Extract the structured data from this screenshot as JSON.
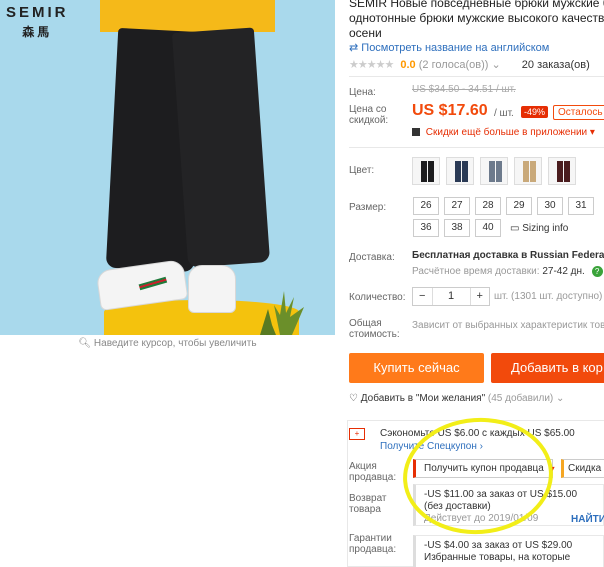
{
  "brand": {
    "name": "SEMIR",
    "sub": "森馬"
  },
  "zoom_hint": "Наведите курсор, чтобы увеличить",
  "product": {
    "title_line1": "SEMIR Новые повседневные брюки мужские бре",
    "title_line2": "однотонные брюки мужские высокого качества",
    "title_line3": "осени",
    "translate_link": "Посмотреть название на английском",
    "stars": "★★★★★",
    "score": "0.0",
    "votes": "(2 голоса(ов))",
    "votes_arrow": "⌄",
    "orders": "20 заказа(ов)"
  },
  "price": {
    "label": "Цена:",
    "old": "US $34.50 - 34.51 / шт.",
    "sale_label": "Цена со скидкой:",
    "new": "US $17.60",
    "per_unit": "/ шт.",
    "discount": "-49%",
    "remaining": "Осталось д",
    "app_discount": "Скидки ещё больше в приложении",
    "app_arrow": "▾"
  },
  "color": {
    "label": "Цвет:",
    "swatches": [
      "#1c1c1e",
      "#2a3a55",
      "#6d7a8c",
      "#c9a97a",
      "#4a1c1e"
    ]
  },
  "size": {
    "label": "Размер:",
    "row1": [
      "26",
      "27",
      "28",
      "29",
      "30",
      "31"
    ],
    "row2": [
      "36",
      "38",
      "40"
    ],
    "sizing_info": "Sizing info"
  },
  "delivery": {
    "label": "Доставка:",
    "main": "Бесплатная доставка в Russian Federation",
    "eta_label": "Расчётное время доставки:",
    "eta": "27-42 дн.",
    "ok": "?"
  },
  "quantity": {
    "label": "Количество:",
    "minus": "−",
    "value": "1",
    "plus": "+",
    "available": "шт. (1301 шт. доступно)"
  },
  "total": {
    "label": "Общая стоимость:",
    "note": "Зависит от выбранных характеристик товар"
  },
  "actions": {
    "buy_now": "Купить сейчас",
    "add_cart": "Добавить в кор",
    "wishlist": "Добавить в \"Мои желания\"",
    "wishlist_count": "(45 добавили)",
    "wishlist_arrow": "⌄"
  },
  "coupons": {
    "save_icon": "+",
    "save_line": "Сэкономьте US $6.00 с каждых US $65.00",
    "save_link": "Получите Спецкупон ›",
    "seller_action_label": "Акция продавца:",
    "get_coupon": "Получить купон продавца",
    "get_coupon_arrow": "▾",
    "discount_tab": "Скидка 1",
    "card1_line1": "-US $11.00 за заказ от US $15.00",
    "card1_line2": "(без доставки)",
    "card1_valid": "Действует до 2019/01/09",
    "find": "НАЙТИ",
    "return_label": "Возврат товара",
    "guarantee_label": "Гарантии продавца:",
    "card2_line1": "-US $4.00 за заказ от US $29.00",
    "card2_line2": "Избранные товары, на которые"
  },
  "colors": {
    "accent": "#f24a0c",
    "buy_now": "#ff7a1a",
    "link": "#2e6fbd",
    "highlight": "#f2ee18"
  }
}
